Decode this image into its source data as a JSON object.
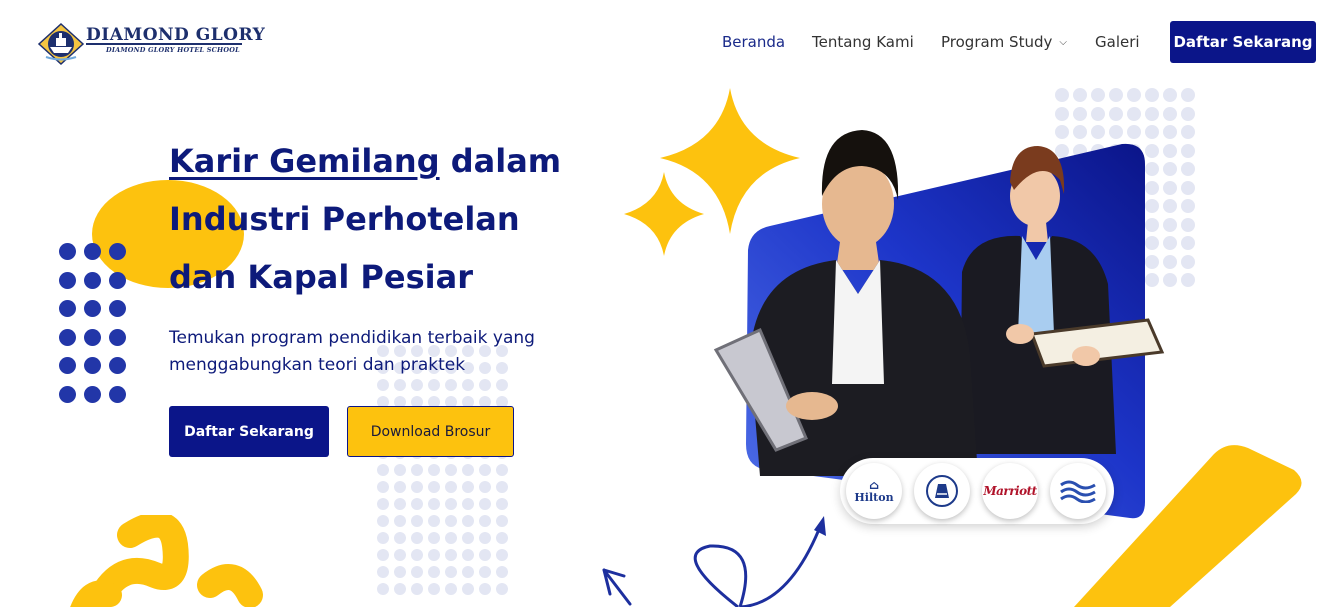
{
  "brand": {
    "name": "DIAMOND GLORY",
    "tagline": "DIAMOND GLORY HOTEL SCHOOL",
    "logo_icon": "ship-emblem-icon"
  },
  "nav": {
    "items": [
      {
        "label": "Beranda",
        "active": true
      },
      {
        "label": "Tentang Kami",
        "active": false
      },
      {
        "label": "Program Study",
        "active": false,
        "has_dropdown": true
      },
      {
        "label": "Galeri",
        "active": false
      }
    ],
    "dropdown_icon": "chevron-down-icon",
    "cta_label": "Daftar Sekarang"
  },
  "hero": {
    "title_highlight": "Karir Gemilang",
    "title_rest": " dalam Industri Perhotelan dan Kapal Pesiar",
    "subtitle": "Temukan program pendidikan terbaik yang menggabungkan teori dan praktek",
    "primary_button": "Daftar Sekarang",
    "secondary_button": "Download Brosur"
  },
  "partners": [
    {
      "name": "Hilton",
      "icon": "hilton-logo-icon"
    },
    {
      "name": "",
      "icon": "cruise-crest-icon"
    },
    {
      "name": "Marriott",
      "icon": "marriott-logo-icon"
    },
    {
      "name": "",
      "icon": "wave-logo-icon"
    }
  ],
  "colors": {
    "primary": "#0b1589",
    "accent": "#fdc20e",
    "hero_panel": "#1830c0",
    "dots_light": "#e3e6f3"
  }
}
